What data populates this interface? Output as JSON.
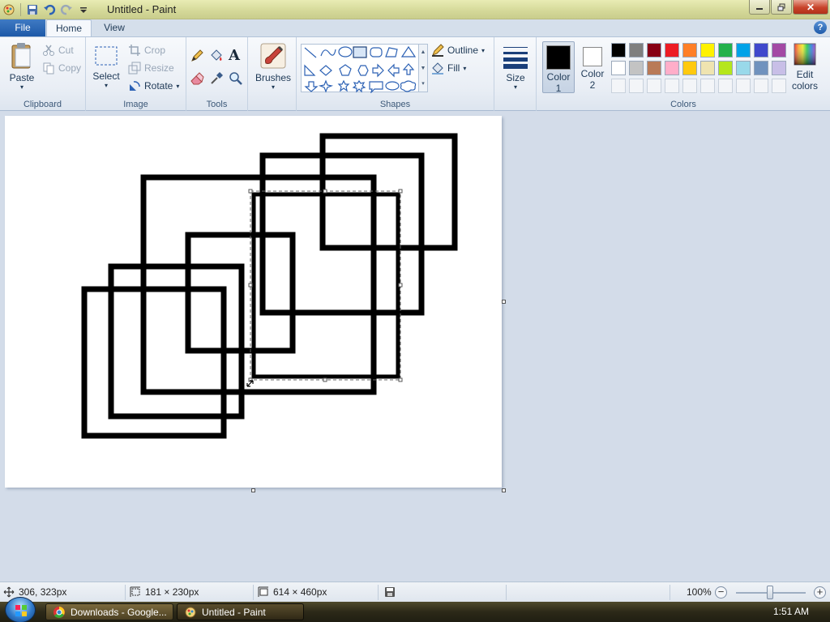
{
  "window": {
    "title": "Untitled - Paint",
    "controls": {
      "minimize": "—",
      "maximize": "❐",
      "close": "✕"
    }
  },
  "tabs": {
    "file": "File",
    "home": "Home",
    "view": "View",
    "help": "?"
  },
  "clipboard": {
    "paste": "Paste",
    "cut": "Cut",
    "copy": "Copy",
    "group": "Clipboard"
  },
  "image": {
    "select": "Select",
    "crop": "Crop",
    "resize": "Resize",
    "rotate": "Rotate",
    "group": "Image"
  },
  "tools": {
    "group": "Tools",
    "text_glyph": "A"
  },
  "brushes": {
    "label": "Brushes"
  },
  "shapes": {
    "outline": "Outline",
    "fill": "Fill",
    "group": "Shapes"
  },
  "size": {
    "label": "Size"
  },
  "colors": {
    "color1_label_a": "Color",
    "color1_label_b": "1",
    "color2_label_a": "Color",
    "color2_label_b": "2",
    "edit_a": "Edit",
    "edit_b": "colors",
    "group": "Colors",
    "color1": "#000000",
    "color2": "#ffffff",
    "palette_row1": [
      "#000000",
      "#7f7f7f",
      "#880015",
      "#ed1c24",
      "#ff7f27",
      "#fff200",
      "#22b14c",
      "#00a2e8",
      "#3f48cc",
      "#a349a4"
    ],
    "palette_row2": [
      "#ffffff",
      "#c3c3c3",
      "#b97a57",
      "#ffaec9",
      "#ffc90e",
      "#efe4b0",
      "#b5e61d",
      "#99d9ea",
      "#7092be",
      "#c8bfe7"
    ]
  },
  "status": {
    "cursor_pos": "306, 323px",
    "selection_size": "181 × 230px",
    "image_size": "614 × 460px",
    "zoom": "100%"
  },
  "taskbar": {
    "chrome_label": "Downloads - Google...",
    "paint_label": "Untitled - Paint",
    "clock": "1:51 AM"
  }
}
